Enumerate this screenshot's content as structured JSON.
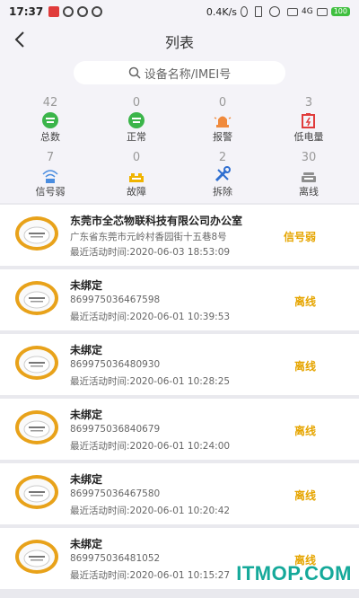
{
  "status_bar": {
    "time": "17:37",
    "network_speed": "0.4K/s",
    "signal": "4G",
    "battery": "100"
  },
  "nav": {
    "title": "列表"
  },
  "search": {
    "placeholder": "设备名称/IMEI号"
  },
  "stats": [
    {
      "count": "42",
      "label": "总数",
      "icon": "total-icon",
      "color": "#3bb54a"
    },
    {
      "count": "0",
      "label": "正常",
      "icon": "normal-icon",
      "color": "#3bb54a"
    },
    {
      "count": "0",
      "label": "报警",
      "icon": "alarm-icon",
      "color": "#f08a3c"
    },
    {
      "count": "3",
      "label": "低电量",
      "icon": "low-battery-icon",
      "color": "#e03b3b"
    },
    {
      "count": "7",
      "label": "信号弱",
      "icon": "weak-signal-icon",
      "color": "#4a8de0"
    },
    {
      "count": "0",
      "label": "故障",
      "icon": "fault-icon",
      "color": "#f0b400"
    },
    {
      "count": "2",
      "label": "拆除",
      "icon": "removed-icon",
      "color": "#2f6fd0"
    },
    {
      "count": "30",
      "label": "离线",
      "icon": "offline-icon",
      "color": "#8e8e8e"
    }
  ],
  "devices": [
    {
      "name": "东莞市全芯物联科技有限公司办公室",
      "sub": "广东省东莞市元岭村香园街十五巷8号",
      "last_active": "最近活动时间:2020-06-03 18:53:09",
      "status": "信号弱"
    },
    {
      "name": "未绑定",
      "sub": "869975036467598",
      "last_active": "最近活动时间:2020-06-01 10:39:53",
      "status": "离线"
    },
    {
      "name": "未绑定",
      "sub": "869975036480930",
      "last_active": "最近活动时间:2020-06-01 10:28:25",
      "status": "离线"
    },
    {
      "name": "未绑定",
      "sub": "869975036840679",
      "last_active": "最近活动时间:2020-06-01 10:24:00",
      "status": "离线"
    },
    {
      "name": "未绑定",
      "sub": "869975036467580",
      "last_active": "最近活动时间:2020-06-01 10:20:42",
      "status": "离线"
    },
    {
      "name": "未绑定",
      "sub": "869975036481052",
      "last_active": "最近活动时间:2020-06-01 10:15:27",
      "status": "离线"
    }
  ],
  "watermark": "ITMOP.COM"
}
